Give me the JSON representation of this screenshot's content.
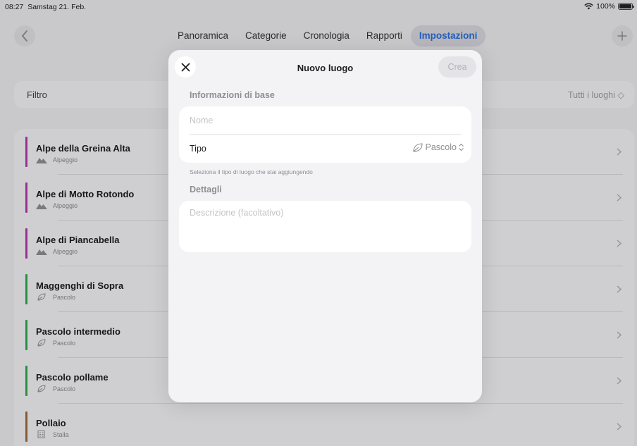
{
  "status": {
    "time": "08:27",
    "date": "Samstag 21. Feb.",
    "battery": "100%"
  },
  "nav": {
    "tabs": [
      {
        "label": "Panoramica"
      },
      {
        "label": "Categorie"
      },
      {
        "label": "Cronologia"
      },
      {
        "label": "Rapporti"
      },
      {
        "label": "Impostazioni",
        "active": true
      }
    ]
  },
  "filter": {
    "label": "Filtro",
    "value": "Tutti i luoghi ◇"
  },
  "list": {
    "items": [
      {
        "title": "Alpe della Greina Alta",
        "type": "Alpeggio",
        "icon": "mountain-icon",
        "color": "#b23aa8"
      },
      {
        "title": "Alpe di Motto Rotondo",
        "type": "Alpeggio",
        "icon": "mountain-icon",
        "color": "#b23aa8"
      },
      {
        "title": "Alpe di Piancabella",
        "type": "Alpeggio",
        "icon": "mountain-icon",
        "color": "#b23aa8"
      },
      {
        "title": "Maggenghi di Sopra",
        "type": "Pascolo",
        "icon": "leaf-icon",
        "color": "#2fa84f"
      },
      {
        "title": "Pascolo intermedio",
        "type": "Pascolo",
        "icon": "leaf-icon",
        "color": "#2fa84f"
      },
      {
        "title": "Pascolo pollame",
        "type": "Pascolo",
        "icon": "leaf-icon",
        "color": "#2fa84f"
      },
      {
        "title": "Pollaio",
        "type": "Stalla",
        "icon": "building-icon",
        "color": "#9c6b3f"
      }
    ]
  },
  "modal": {
    "title": "Nuovo luogo",
    "create_label": "Crea",
    "basic_section": "Informazioni di base",
    "name_placeholder": "Nome",
    "type_label": "Tipo",
    "type_value": "Pascolo",
    "hint": "Seleziona il tipo di luogo che stai aggiungendo",
    "details_section": "Dettagli",
    "description_placeholder": "Descrizione (facoltativo)"
  }
}
